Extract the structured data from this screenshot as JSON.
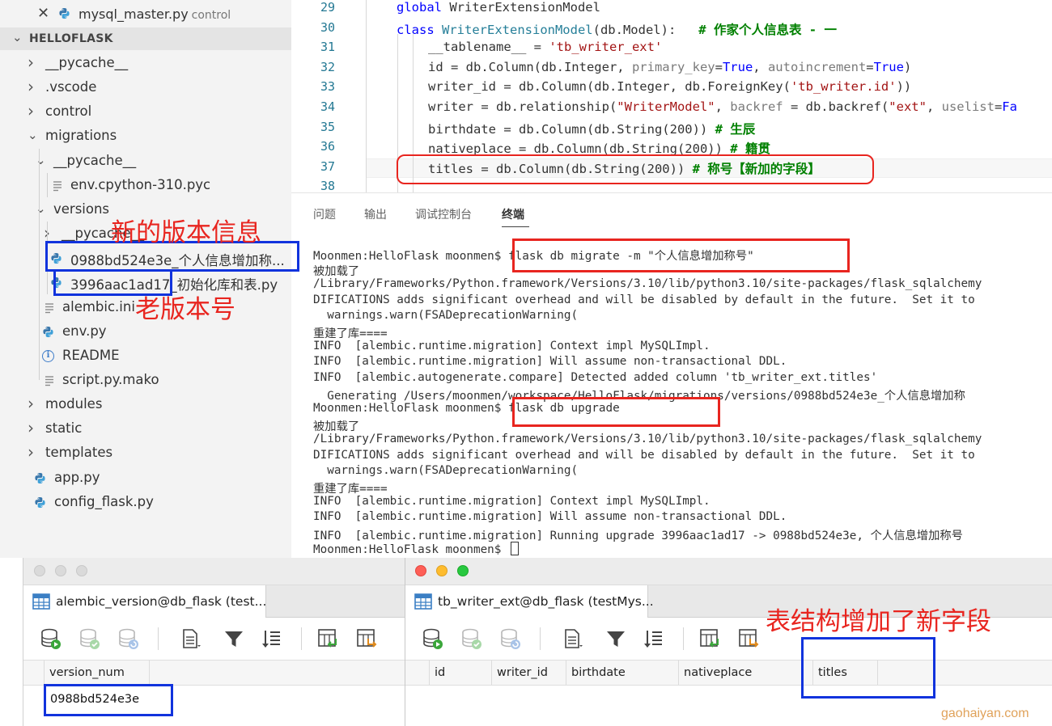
{
  "sidebar": {
    "open_editor": {
      "file": "mysql_master.py",
      "dir": "control",
      "close_glyph": "✕"
    },
    "section_title": "HELLOFLASK",
    "items": [
      {
        "label": "__pycache__",
        "kind": "folder",
        "expanded": false
      },
      {
        "label": ".vscode",
        "kind": "folder",
        "expanded": false
      },
      {
        "label": "control",
        "kind": "folder",
        "expanded": false
      },
      {
        "label": "migrations",
        "kind": "folder",
        "expanded": true
      },
      {
        "label": "__pycache__",
        "kind": "folder",
        "expanded": true
      },
      {
        "label": "env.cpython-310.pyc",
        "kind": "file"
      },
      {
        "label": "versions",
        "kind": "folder",
        "expanded": true
      },
      {
        "label": "__pycache__",
        "kind": "folder",
        "expanded": false
      },
      {
        "label": "0988bd524e3e_个人信息增加称...",
        "kind": "python"
      },
      {
        "label": "3996aac1ad17_初始化库和表.py",
        "kind": "python"
      },
      {
        "label": "alembic.ini",
        "kind": "file"
      },
      {
        "label": "env.py",
        "kind": "python"
      },
      {
        "label": "README",
        "kind": "info"
      },
      {
        "label": "script.py.mako",
        "kind": "file"
      },
      {
        "label": "modules",
        "kind": "folder",
        "expanded": false
      },
      {
        "label": "static",
        "kind": "folder",
        "expanded": false
      },
      {
        "label": "templates",
        "kind": "folder",
        "expanded": false
      },
      {
        "label": "app.py",
        "kind": "python"
      },
      {
        "label": "config_flask.py",
        "kind": "python"
      }
    ]
  },
  "editor": {
    "line_numbers": [
      "29",
      "30",
      "31",
      "32",
      "33",
      "34",
      "35",
      "36",
      "37",
      "38"
    ],
    "lines": [
      [
        [
          "kw",
          "global "
        ],
        [
          "",
          "WriterExtensionModel"
        ]
      ],
      [
        [
          "kw",
          "class "
        ],
        [
          "cls",
          "WriterExtensionModel"
        ],
        [
          "",
          "(db.Model):   "
        ],
        [
          "cmt",
          "# 作家个人信息表 - 一"
        ]
      ],
      [
        [
          "",
          "__tablename__ = "
        ],
        [
          "str",
          "'tb_writer_ext'"
        ]
      ],
      [
        [
          "",
          "id = db.Column(db.Integer, "
        ],
        [
          "param",
          "primary_key"
        ],
        [
          "",
          "="
        ],
        [
          "const",
          "True"
        ],
        [
          "",
          ", "
        ],
        [
          "param",
          "autoincrement"
        ],
        [
          "",
          "="
        ],
        [
          "const",
          "True"
        ],
        [
          "",
          ")"
        ]
      ],
      [
        [
          "",
          "writer_id = db.Column(db.Integer, db.ForeignKey("
        ],
        [
          "str",
          "'tb_writer.id'"
        ],
        [
          "",
          "))"
        ]
      ],
      [
        [
          "",
          "writer = db.relationship("
        ],
        [
          "str",
          "\"WriterModel\""
        ],
        [
          "",
          ", "
        ],
        [
          "param",
          "backref"
        ],
        [
          "",
          " = db.backref("
        ],
        [
          "str",
          "\"ext\""
        ],
        [
          "",
          ", "
        ],
        [
          "param",
          "uselist"
        ],
        [
          "",
          "="
        ],
        [
          "const",
          "Fa"
        ]
      ],
      [
        [
          "",
          "birthdate = db.Column(db.String(200)) "
        ],
        [
          "cmt",
          "# 生辰"
        ]
      ],
      [
        [
          "",
          "nativeplace = db.Column(db.String(200)) "
        ],
        [
          "cmt",
          "# 籍贯"
        ]
      ],
      [
        [
          "",
          "titles = db.Column(db.String(200)) "
        ],
        [
          "cmt",
          "# 称号【新加的字段】"
        ]
      ],
      []
    ]
  },
  "panel": {
    "tabs": [
      "问题",
      "输出",
      "调试控制台",
      "终端"
    ],
    "active_tab": "终端",
    "terminal_lines": [
      "Moonmen:HelloFlask moonmen$ flask db migrate -m \"个人信息增加称号\"",
      "被加载了",
      "/Library/Frameworks/Python.framework/Versions/3.10/lib/python3.10/site-packages/flask_sqlalchemy",
      "DIFICATIONS adds significant overhead and will be disabled by default in the future.  Set it to",
      "  warnings.warn(FSADeprecationWarning(",
      "重建了库====",
      "INFO  [alembic.runtime.migration] Context impl MySQLImpl.",
      "INFO  [alembic.runtime.migration] Will assume non-transactional DDL.",
      "INFO  [alembic.autogenerate.compare] Detected added column 'tb_writer_ext.titles'",
      "  Generating /Users/moonmen/workspace/HelloFlask/migrations/versions/0988bd524e3e_个人信息增加称",
      "Moonmen:HelloFlask moonmen$ flask db upgrade",
      "被加载了",
      "/Library/Frameworks/Python.framework/Versions/3.10/lib/python3.10/site-packages/flask_sqlalchemy",
      "DIFICATIONS adds significant overhead and will be disabled by default in the future.  Set it to",
      "  warnings.warn(FSADeprecationWarning(",
      "重建了库====",
      "INFO  [alembic.runtime.migration] Context impl MySQLImpl.",
      "INFO  [alembic.runtime.migration] Will assume non-transactional DDL.",
      "INFO  [alembic.runtime.migration] Running upgrade 3996aac1ad17 -> 0988bd524e3e, 个人信息增加称号",
      "Moonmen:HelloFlask moonmen$ "
    ]
  },
  "db_left": {
    "tab_title": "alembic_version@db_flask (test...",
    "columns": [
      "version_num"
    ],
    "rows": [
      [
        "0988bd524e3e"
      ]
    ]
  },
  "db_right": {
    "tab_title": "tb_writer_ext@db_flask (testMys...",
    "columns": [
      "id",
      "writer_id",
      "birthdate",
      "nativeplace",
      "titles"
    ]
  },
  "annotations": {
    "new_version": "新的版本信息",
    "old_version": "老版本号",
    "new_field": "表结构增加了新字段"
  },
  "watermark": "gaohaiyan.com",
  "colors": {
    "red_annotation": "#e8251f",
    "blue_annotation": "#1133dd",
    "keyword": "#0000ff",
    "class_name": "#267f99",
    "string": "#a31515",
    "comment": "#008000",
    "line_number": "#237893",
    "watermark": "#e0a25a"
  }
}
